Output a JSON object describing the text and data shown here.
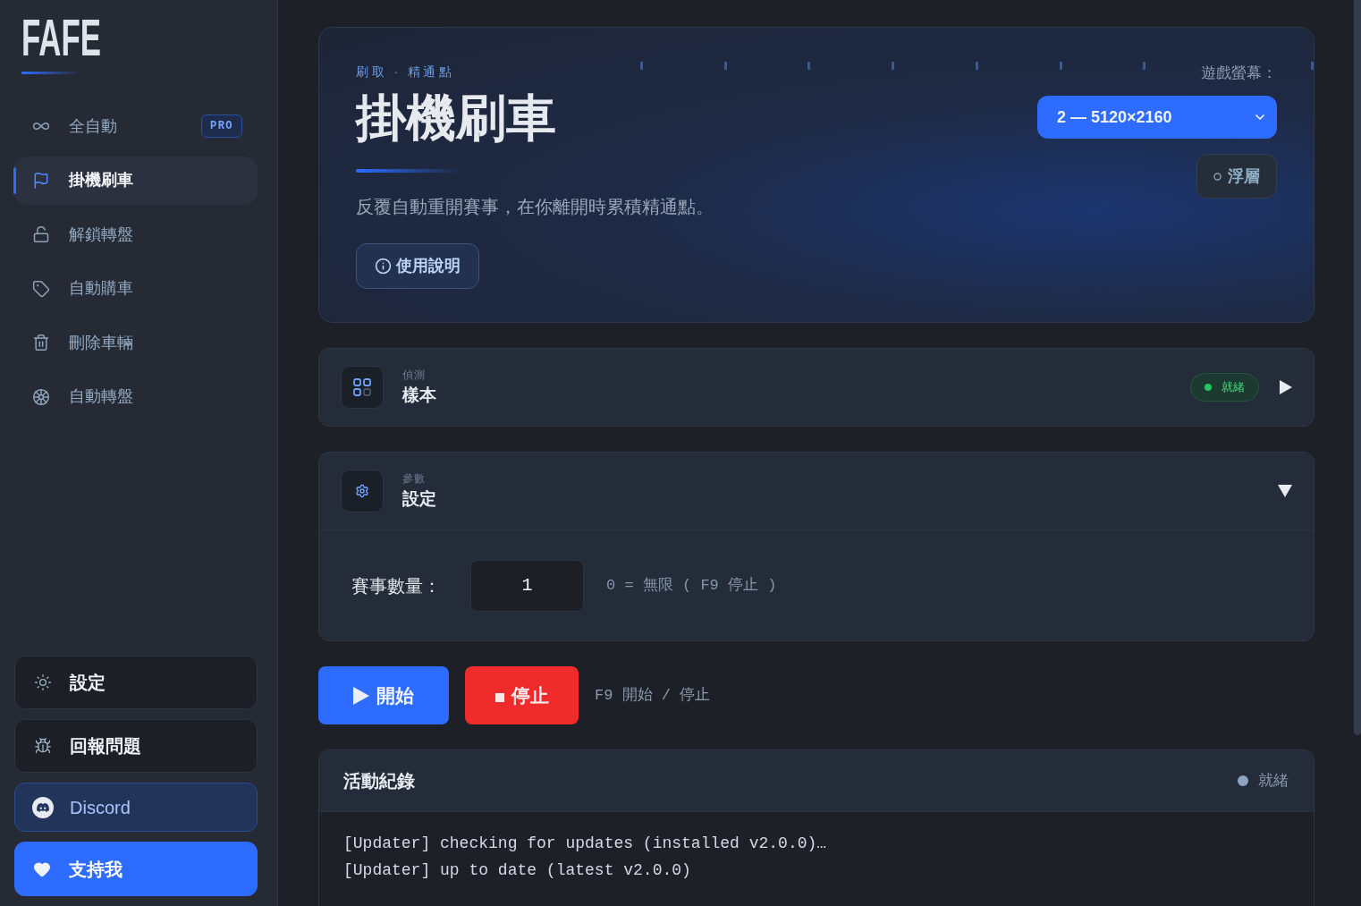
{
  "sidebar": {
    "logo": "FAFE",
    "nav_items": [
      {
        "label": "全自動",
        "badge": "PRO",
        "selected": false
      },
      {
        "label": "掛機刷車",
        "selected": true
      },
      {
        "label": "解鎖轉盤",
        "selected": false
      },
      {
        "label": "自動購車",
        "selected": false
      },
      {
        "label": "刪除車輛",
        "selected": false
      },
      {
        "label": "自動轉盤",
        "selected": false
      }
    ],
    "footer_buttons": [
      {
        "label": "設定",
        "kind": "plain"
      },
      {
        "label": "回報問題",
        "kind": "plain"
      },
      {
        "label": "Discord",
        "kind": "link"
      },
      {
        "label": "支持我",
        "kind": "primary"
      }
    ]
  },
  "hero": {
    "eyebrow": "刷取 · 精通點",
    "title": "掛機刷車",
    "description": "反覆自動重開賽事，在你離開時累積精通點。",
    "help_button": "使用說明",
    "screen_label": "遊戲螢幕：",
    "screen_select": {
      "value": "2 — 5120×2160"
    },
    "overlay_button": {
      "label": "浮層",
      "on": false
    }
  },
  "panels": [
    {
      "eyebrow": "偵測",
      "title": "樣本",
      "status": {
        "label": "就緒",
        "color": "#22c55e"
      },
      "expanded": false
    },
    {
      "eyebrow": "參數",
      "title": "設定",
      "expanded": true,
      "fields": [
        {
          "label": "賽事數量：",
          "value": "1",
          "hint": "0 = 無限 ( F9 停止 )"
        }
      ]
    }
  ],
  "actions": {
    "buttons": [
      {
        "label": "開始",
        "kind": "start"
      },
      {
        "label": "停止",
        "kind": "stop"
      }
    ],
    "hint": "F9 開始 / 停止"
  },
  "activity_log": {
    "title": "活動紀錄",
    "status": {
      "label": "就緒",
      "color": "#8ea4bf"
    },
    "lines": [
      "[Updater] checking for updates (installed v2.0.0)…",
      "[Updater] up to date (latest v2.0.0)"
    ]
  }
}
